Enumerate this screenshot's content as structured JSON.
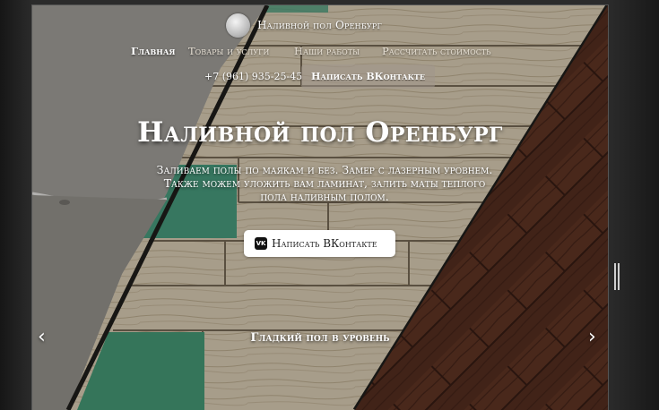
{
  "header": {
    "brand": "Наливной пол Оренбург",
    "nav": [
      {
        "label": "Главная",
        "active": true
      },
      {
        "label": "Товары и услуги",
        "active": false
      },
      {
        "label": "Наши работы",
        "active": false
      },
      {
        "label": "Рассчитать стоимость",
        "active": false
      }
    ],
    "phone": "+7 (961) 935-25-45",
    "vk_button": "Написать ВКонтакте"
  },
  "hero": {
    "title": "Наливной пол Оренбург",
    "subtitle": "Заливаем полы по маякам и без. Замер с лазерным уровнем. Также можем уложить вам ламинат, залить маты теплого пола наливным полом.",
    "cta": "Написать ВКонтакте",
    "cta_icon": "vk-icon",
    "vk_glyph": "VK"
  },
  "slider": {
    "caption": "Гладкий пол в уровень",
    "prev": "‹",
    "next": "›"
  },
  "colors": {
    "wood_light": "#d7cbb4",
    "wood_dark": "#4a2418",
    "green_tile": "#3f9a78",
    "grey": "#9a9a98"
  }
}
